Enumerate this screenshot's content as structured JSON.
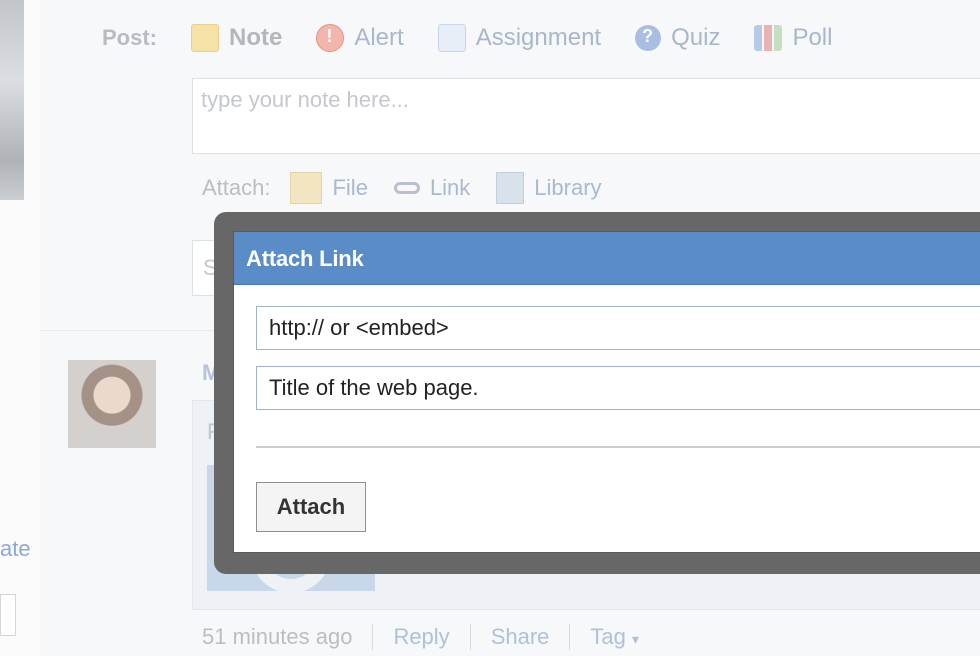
{
  "left": {
    "partial_link": "ate"
  },
  "composer": {
    "post_label": "Post:",
    "post_types": [
      {
        "label": "Note",
        "icon": "note-icon"
      },
      {
        "label": "Alert",
        "icon": "alert-icon"
      },
      {
        "label": "Assignment",
        "icon": "assignment-icon"
      },
      {
        "label": "Quiz",
        "icon": "quiz-icon"
      },
      {
        "label": "Poll",
        "icon": "poll-icon"
      }
    ],
    "note_placeholder": "type your note here...",
    "attach_label": "Attach:",
    "attach_items": [
      {
        "label": "File",
        "icon": "file-icon"
      },
      {
        "label": "Link",
        "icon": "link-icon"
      },
      {
        "label": "Library",
        "icon": "library-icon"
      }
    ],
    "send_partial": "Se"
  },
  "feed": {
    "author_partial": "Me",
    "quote_partial": "Fla",
    "timestamp": "51 minutes ago",
    "actions": [
      "Reply",
      "Share",
      "Tag"
    ],
    "tag_caret": "▾"
  },
  "modal": {
    "title": "Attach Link",
    "url_placeholder": "http:// or <embed>",
    "title_placeholder": "Title of the web page.",
    "attach_button": "Attach"
  },
  "colors": {
    "modal_header": "#5a8cc8",
    "modal_frame": "#676767"
  }
}
